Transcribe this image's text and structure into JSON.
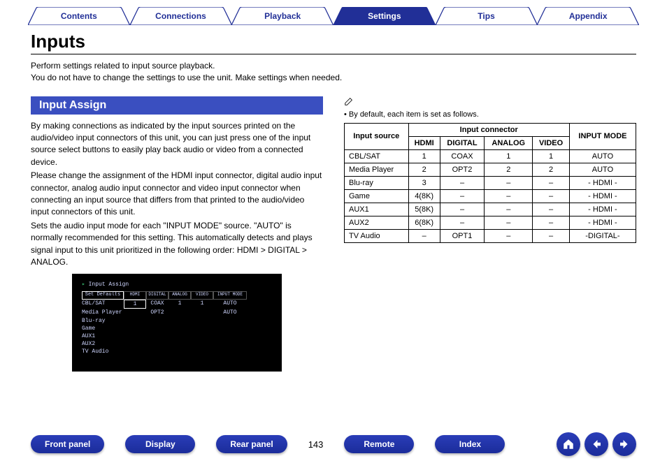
{
  "top_tabs": {
    "contents": "Contents",
    "connections": "Connections",
    "playback": "Playback",
    "settings": "Settings",
    "tips": "Tips",
    "appendix": "Appendix",
    "active": "settings"
  },
  "page_title": "Inputs",
  "intro": {
    "line1": "Perform settings related to input source playback.",
    "line2": "You do not have to change the settings to use the unit. Make settings when needed."
  },
  "section_heading": "Input Assign",
  "body_paras": {
    "p1": "By making connections as indicated by the input sources printed on the audio/video input connectors of this unit, you can just press one of the input source select buttons to easily play back audio or video from a connected device.",
    "p2": "Please change the assignment of the HDMI input connector, digital audio input connector, analog audio input connector and video input connector when connecting an input source that differs from that printed to the audio/video input connectors of this unit.",
    "p3": "Sets the audio input mode for each \"INPUT MODE\" source. \"AUTO\" is normally recommended for this setting. This automatically detects and plays signal input to this unit prioritized in the following order: HDMI > DIGITAL > ANALOG."
  },
  "osd": {
    "title": "Input Assign",
    "set_defaults": "Set Defaults",
    "head": [
      "HDMI",
      "DIGITAL",
      "ANALOG",
      "VIDEO",
      "INPUT MODE"
    ],
    "rows": [
      {
        "label": "CBL/SAT",
        "cells": [
          "1",
          "COAX",
          "1",
          "1",
          "AUTO"
        ]
      },
      {
        "label": "Media Player",
        "cells": [
          "",
          "OPT2",
          "",
          "",
          "AUTO"
        ]
      },
      {
        "label": "Blu-ray",
        "cells": [
          "",
          "",
          "",
          "",
          ""
        ]
      },
      {
        "label": "Game",
        "cells": [
          "",
          "",
          "",
          "",
          ""
        ]
      },
      {
        "label": "AUX1",
        "cells": [
          "",
          "",
          "",
          "",
          ""
        ]
      },
      {
        "label": "AUX2",
        "cells": [
          "",
          "",
          "",
          "",
          ""
        ]
      },
      {
        "label": "TV Audio",
        "cells": [
          "",
          "",
          "",
          "",
          ""
        ]
      }
    ]
  },
  "note_text": "By default, each item is set as follows.",
  "table": {
    "h_src": "Input source",
    "h_conn": "Input connector",
    "h_hdmi": "HDMI",
    "h_digital": "DIGITAL",
    "h_analog": "ANALOG",
    "h_video": "VIDEO",
    "h_mode": "INPUT MODE",
    "rows": [
      {
        "src": "CBL/SAT",
        "hdmi": "1",
        "digital": "COAX",
        "analog": "1",
        "video": "1",
        "mode": "AUTO"
      },
      {
        "src": "Media Player",
        "hdmi": "2",
        "digital": "OPT2",
        "analog": "2",
        "video": "2",
        "mode": "AUTO"
      },
      {
        "src": "Blu-ray",
        "hdmi": "3",
        "digital": "–",
        "analog": "–",
        "video": "–",
        "mode": "- HDMI -"
      },
      {
        "src": "Game",
        "hdmi": "4(8K)",
        "digital": "–",
        "analog": "–",
        "video": "–",
        "mode": "- HDMI -"
      },
      {
        "src": "AUX1",
        "hdmi": "5(8K)",
        "digital": "–",
        "analog": "–",
        "video": "–",
        "mode": "- HDMI -"
      },
      {
        "src": "AUX2",
        "hdmi": "6(8K)",
        "digital": "–",
        "analog": "–",
        "video": "–",
        "mode": "- HDMI -"
      },
      {
        "src": "TV Audio",
        "hdmi": "–",
        "digital": "OPT1",
        "analog": "–",
        "video": "–",
        "mode": "-DIGITAL-"
      }
    ]
  },
  "bottom_nav": {
    "front_panel": "Front panel",
    "display": "Display",
    "rear_panel": "Rear panel",
    "page_num": "143",
    "remote": "Remote",
    "index": "Index"
  }
}
